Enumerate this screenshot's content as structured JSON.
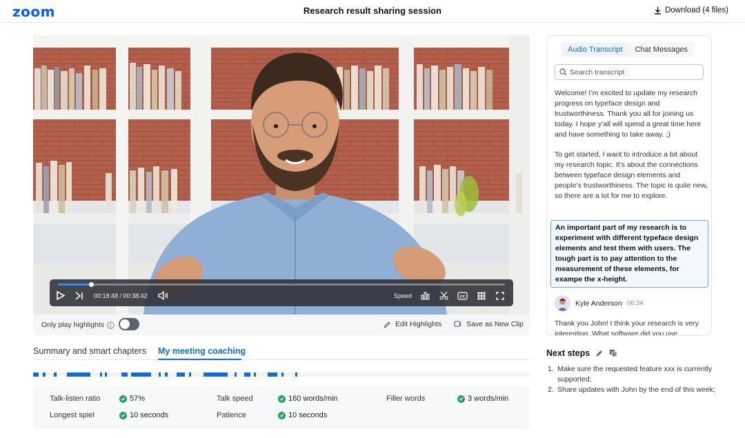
{
  "header": {
    "logo": "zoom",
    "title": "Research result sharing session",
    "download_label": "Download (4 files)"
  },
  "player": {
    "time_display": "00:18:48 / 00:38:42",
    "speed_label": "Speed",
    "progress": 0.074
  },
  "video_bar": {
    "only_highlights": "Only play highlights",
    "edit_highlights": "Edit Highlights",
    "save_clip": "Save as New Clip"
  },
  "tabs": [
    {
      "label": "Summary and smart chapters"
    },
    {
      "label": "My meeting coaching"
    }
  ],
  "stats": {
    "talk_listen_label": "Talk-listen ratio",
    "talk_listen_value": "57%",
    "talk_speed_label": "Talk speed",
    "talk_speed_value": "160 words/min",
    "filler_label": "Filler words",
    "filler_value": "3 words/min",
    "spiel_label": "Longest spiel",
    "spiel_value": "10 seconds",
    "patience_label": "Patience",
    "patience_value": "10 seconds"
  },
  "panel": {
    "tab_transcript": "Audio Transcript",
    "tab_chat": "Chat Messages",
    "search_placeholder": "Search transcript",
    "para1": "Welcome! I’m excited to update my research progress on typeface design and trustworthiness. Thank you all for joining us today. I hope y’all will spend a great time here and have something to take away. ;)",
    "para2": "To get started, I want to introduce a bit about my research topic. It’s about the connections between typeface design elements and people’s trustworthiness. The topic is quite new, so there are a lot for me to explore.",
    "highlight": "An important part of my research is to experiment with different typeface design elements and test them with users. The tough part is to pay attention to the measurement of these elements, for exampe the x-height.",
    "speaker_name": "Kyle Anderson",
    "speaker_time": "06:34",
    "reply": "Thank you John! I think your research is very interesting. What software did you use"
  },
  "next_steps": {
    "title": "Next steps",
    "items": [
      "Make sure the requested feature xxx is currently supported;",
      "Share updates with John by the end of this week;"
    ]
  },
  "colors": {
    "accent": "#0e6bd8",
    "logo": "#0b5cff",
    "success": "#21a35a"
  }
}
